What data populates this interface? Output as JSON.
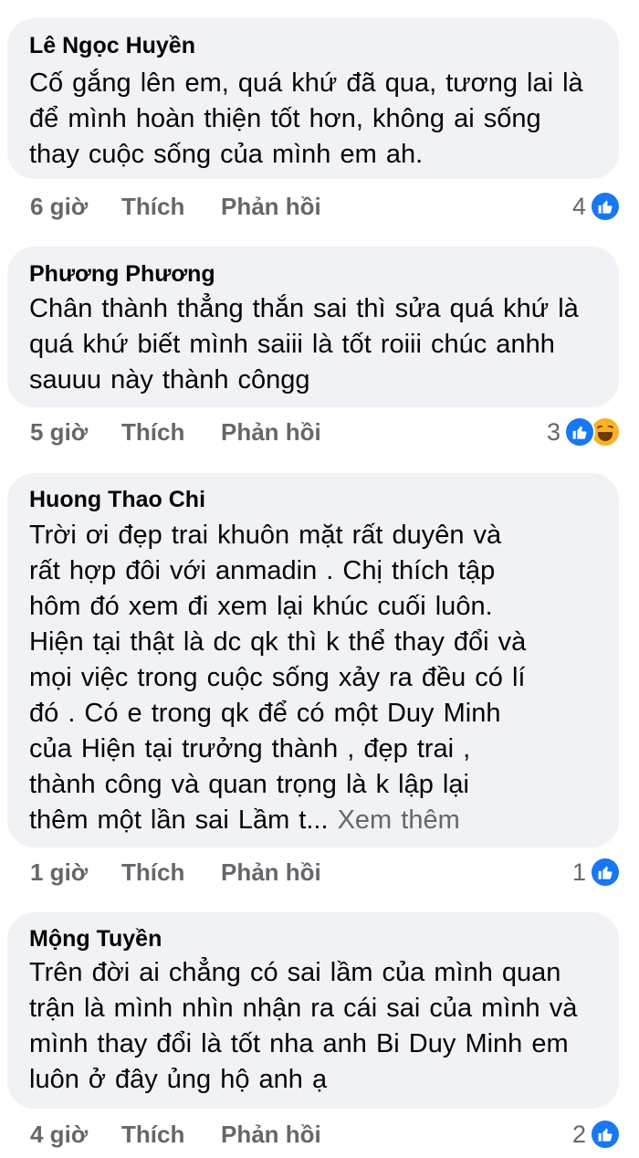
{
  "comments": [
    {
      "author": "Lê Ngọc Huyền",
      "lines": [
        "Cố gắng lên em, quá khứ đã qua, tương lai là",
        "để mình hoàn thiện tốt hơn, không ai sống",
        "thay cuộc sống của mình em ah."
      ],
      "time": "6 giờ",
      "like_label": "Thích",
      "reply_label": "Phản hồi",
      "reaction_count": "4",
      "reactions": [
        "like-icon"
      ]
    },
    {
      "author": "Phương Phương",
      "lines": [
        "Chân thành thẳng thắn sai thì sửa quá khứ là",
        "quá khứ biết mình saiii là tốt roiii chúc anhh",
        "sauuu này thành côngg"
      ],
      "time": "5 giờ",
      "like_label": "Thích",
      "reply_label": "Phản hồi",
      "reaction_count": "3",
      "reactions": [
        "like-icon",
        "haha-icon"
      ]
    },
    {
      "author": "Huong Thao Chi",
      "lines": [
        "Trời ơi  đẹp  trai khuôn mặt  rất  duyên  và",
        "rất  hợp  đôi  với  anmadin  . Chị  thích  tập",
        "hôm  đó  xem  đi xem lại  khúc  cuối  luôn.",
        "Hiện  tại  thật  là  dc qk thì  k thể  thay  đổi  và",
        "mọi  việc  trong  cuộc sống  xảy  ra đều  có  lí",
        "đó . Có  e trong  qk để  có  một  Duy Minh",
        "của  Hiện  tại  trưởng  thành  , đẹp  trai ,",
        "thành  công  và  quan  trọng là  k lập  lại",
        "thêm một  lần sai Lầm  t..."
      ],
      "see_more": "Xem thêm",
      "time": "1 giờ",
      "like_label": "Thích",
      "reply_label": "Phản hồi",
      "reaction_count": "1",
      "reactions": [
        "like-icon"
      ]
    },
    {
      "author": "Mộng Tuyền",
      "lines": [
        "Trên đời ai chẳng có sai lầm của mình quan",
        "trận là mình nhìn nhận ra cái sai của mình và",
        "mình thay đổi là tốt nha anh Bi Duy Minh  em",
        "luôn ở đây ủng hộ anh ạ"
      ],
      "time": "4 giờ",
      "like_label": "Thích",
      "reply_label": "Phản hồi",
      "reaction_count": "2",
      "reactions": [
        "like-icon"
      ]
    }
  ],
  "colors": {
    "bubble": "#f0f2f5",
    "text": "#050505",
    "secondary": "#65676b",
    "like_blue": "#1877f2",
    "haha_yellow": "#f7b125"
  }
}
